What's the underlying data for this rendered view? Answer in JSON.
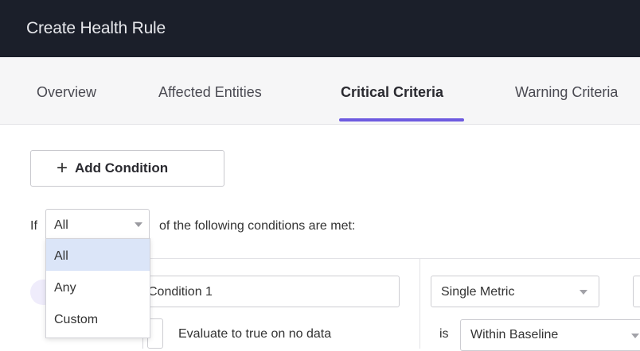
{
  "window": {
    "title": "Create Health Rule"
  },
  "tabs": [
    {
      "label": "Overview",
      "active": false
    },
    {
      "label": "Affected Entities",
      "active": false
    },
    {
      "label": "Critical Criteria",
      "active": true
    },
    {
      "label": "Warning Criteria",
      "active": false
    }
  ],
  "toolbar": {
    "add_condition_label": "Add Condition",
    "add_icon": "+"
  },
  "condition_match": {
    "if_label": "If",
    "selected": "All",
    "suffix": "of the following conditions are met:",
    "options": [
      "All",
      "Any",
      "Custom"
    ]
  },
  "condition": {
    "name_value": "Condition 1",
    "evaluate_label": "Evaluate to true on no data",
    "metric_type": "Single Metric",
    "is_label": "is",
    "comparison": "Within Baseline"
  },
  "colors": {
    "accent": "#6d5ae0",
    "titlebar": "#1b1f2a",
    "selected_option": "#dbe5f8"
  }
}
